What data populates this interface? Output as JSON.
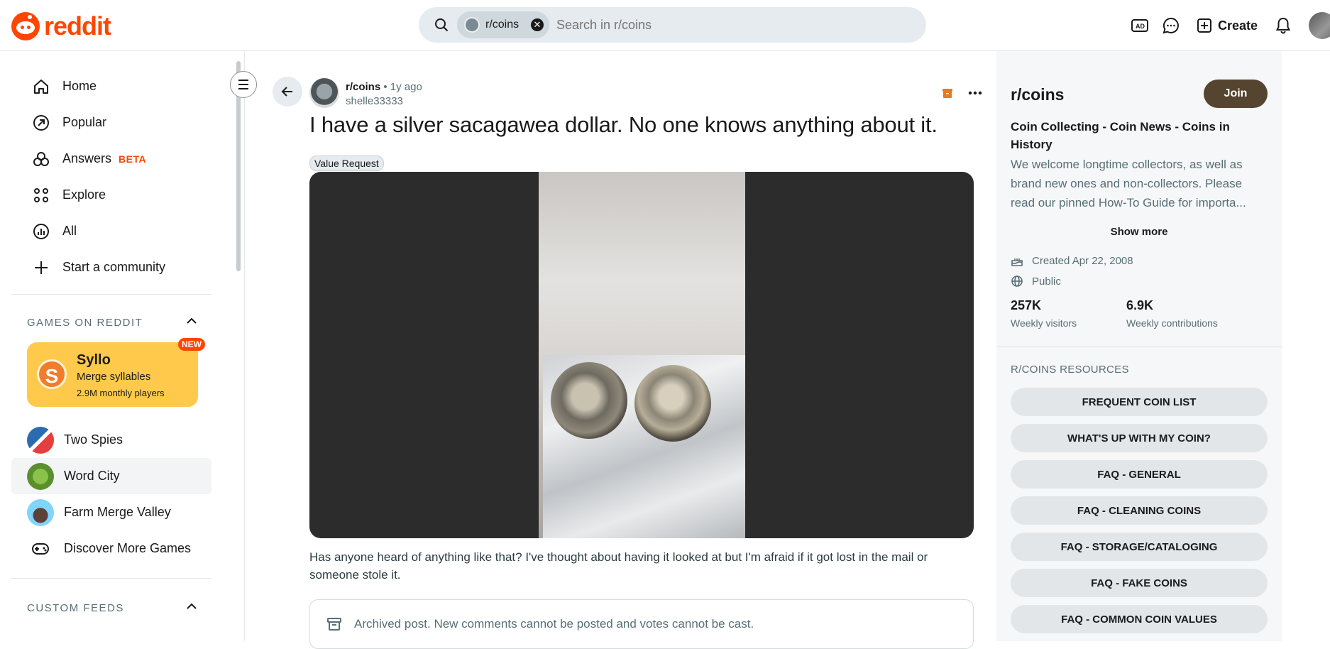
{
  "header": {
    "logo_text": "reddit",
    "search_chip": "r/coins",
    "search_placeholder": "Search in r/coins",
    "create_label": "Create"
  },
  "sidebar": {
    "nav": [
      {
        "label": "Home",
        "icon": "home-icon"
      },
      {
        "label": "Popular",
        "icon": "popular-icon"
      },
      {
        "label": "Answers",
        "badge": "BETA",
        "icon": "answers-icon"
      },
      {
        "label": "Explore",
        "icon": "explore-icon"
      },
      {
        "label": "All",
        "icon": "all-icon"
      },
      {
        "label": "Start a community",
        "icon": "plus-icon"
      }
    ],
    "games_heading": "GAMES ON REDDIT",
    "featured_game": {
      "title": "Syllo",
      "subtitle": "Merge syllables",
      "players": "2.9M monthly players",
      "badge": "NEW"
    },
    "games": [
      "Two Spies",
      "Word City",
      "Farm Merge Valley",
      "Discover More Games"
    ],
    "custom_feeds_heading": "CUSTOM FEEDS"
  },
  "post": {
    "subreddit": "r/coins",
    "age": "1y ago",
    "author": "shelle33333",
    "title": "I have a silver sacagawea dollar. No one knows anything about it.",
    "flair": "Value Request",
    "body": "Has anyone heard of anything like that? I've thought about having it looked at but I'm afraid if it got lost in the mail or someone stole it.",
    "archived_notice": "Archived post. New comments cannot be posted and votes cannot be cast."
  },
  "community": {
    "name": "r/coins",
    "join_label": "Join",
    "headline": "Coin Collecting - Coin News - Coins in History",
    "description": "We welcome longtime collectors, as well as brand new ones and non-collectors. Please read our pinned How-To Guide for importa...",
    "show_more": "Show more",
    "created": "Created Apr 22, 2008",
    "visibility": "Public",
    "weekly_visitors_value": "257K",
    "weekly_visitors_label": "Weekly visitors",
    "weekly_contrib_value": "6.9K",
    "weekly_contrib_label": "Weekly contributions",
    "resources_heading": "R/COINS RESOURCES",
    "resources": [
      "FREQUENT COIN LIST",
      "WHAT'S UP WITH MY COIN?",
      "FAQ - GENERAL",
      "FAQ - CLEANING COINS",
      "FAQ - STORAGE/CATALOGING",
      "FAQ - FAKE COINS",
      "FAQ - COMMON COIN VALUES"
    ]
  },
  "colors": {
    "brand": "#ff4500",
    "join": "#55442f",
    "game_card": "#ffc94b"
  }
}
